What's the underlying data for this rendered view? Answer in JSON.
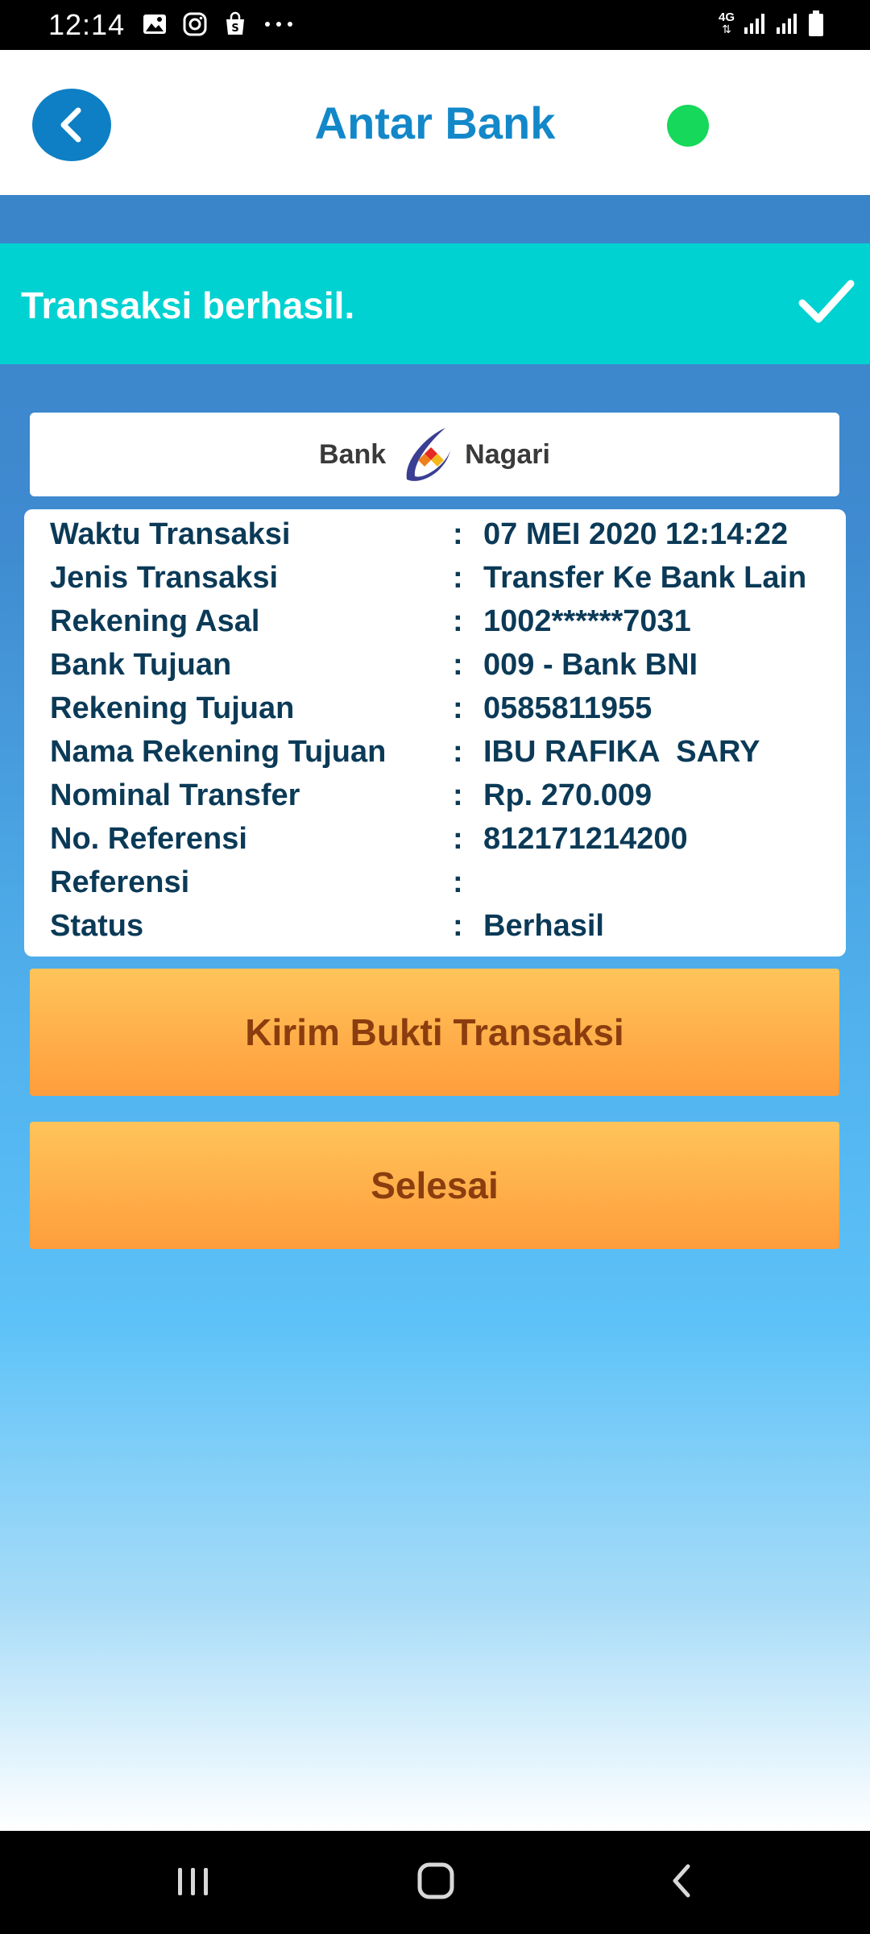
{
  "status_bar": {
    "time": "12:14",
    "left_icons": [
      "image-icon",
      "instagram-icon",
      "shop-icon",
      "more-dots-icon"
    ],
    "network_label": "4G",
    "right_icons": [
      "signal-icon",
      "signal-icon",
      "battery-icon"
    ]
  },
  "header": {
    "title": "Antar Bank",
    "back_icon": "chevron-left-icon",
    "status_dot_color": "#16d85a"
  },
  "banner": {
    "message": "Transaksi berhasil.",
    "icon": "check-icon",
    "color": "#00d1d1"
  },
  "logo": {
    "word_left": "Bank",
    "word_right": "Nagari"
  },
  "details": [
    {
      "label": "Waktu Transaksi",
      "colon": ":",
      "value": "07 MEI 2020 12:14:22"
    },
    {
      "label": "Jenis Transaksi",
      "colon": ":",
      "value": "Transfer Ke Bank Lain"
    },
    {
      "label": "Rekening Asal",
      "colon": ":",
      "value": "1002******7031"
    },
    {
      "label": "Bank Tujuan",
      "colon": ":",
      "value": "009 - Bank BNI"
    },
    {
      "label": "Rekening Tujuan",
      "colon": ":",
      "value": "0585811955"
    },
    {
      "label": "Nama Rekening Tujuan",
      "colon": ":",
      "value": "IBU RAFIKA  SARY"
    },
    {
      "label": "Nominal Transfer",
      "colon": ":",
      "value": "Rp. 270.009"
    },
    {
      "label": "No. Referensi",
      "colon": ":",
      "value": "812171214200"
    },
    {
      "label": "Referensi",
      "colon": ":",
      "value": ""
    },
    {
      "label": "Status",
      "colon": ":",
      "value": "Berhasil"
    }
  ],
  "buttons": {
    "send_receipt": "Kirim Bukti Transaksi",
    "done": "Selesai"
  },
  "nav_bar": {
    "items": [
      "recent-apps-icon",
      "home-icon",
      "back-icon"
    ]
  }
}
